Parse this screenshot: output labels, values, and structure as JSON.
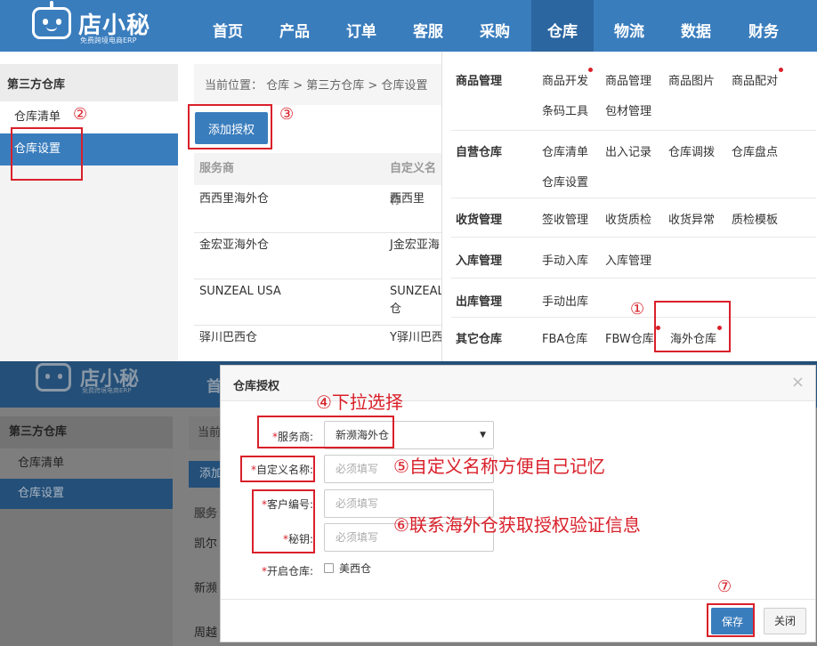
{
  "top": {
    "logo": {
      "text": "店小秘",
      "sub": "免费跨境电商ERP"
    },
    "nav": [
      "首页",
      "产品",
      "订单",
      "客服",
      "采购",
      "仓库",
      "物流",
      "数据",
      "财务"
    ],
    "sidebar": {
      "title": "第三方仓库",
      "items": [
        "仓库清单",
        "仓库设置"
      ]
    },
    "breadcrumb": "当前位置： 仓库 > 第三方仓库 > 仓库设置",
    "add_button": "添加授权",
    "table": {
      "headers": [
        "服务商",
        "自定义名称"
      ],
      "rows": [
        [
          "西西里海外仓",
          "西西里"
        ],
        [
          "金宏亚海外仓",
          "J金宏亚海"
        ],
        [
          "SUNZEAL USA",
          "SUNZEAL",
          "仓"
        ],
        [
          "驿川巴西仓",
          "Y驿川巴西"
        ]
      ]
    },
    "menu": {
      "sections": [
        {
          "name": "商品管理",
          "links": [
            "商品开发",
            "商品管理",
            "商品图片",
            "商品配对",
            "条码工具",
            "包材管理"
          ]
        },
        {
          "name": "自营仓库",
          "links": [
            "仓库清单",
            "出入记录",
            "仓库调拨",
            "仓库盘点",
            "仓库设置"
          ]
        },
        {
          "name": "收货管理",
          "links": [
            "签收管理",
            "收货质检",
            "收货异常",
            "质检模板"
          ]
        },
        {
          "name": "入库管理",
          "links": [
            "手动入库",
            "入库管理"
          ]
        },
        {
          "name": "出库管理",
          "links": [
            "手动出库"
          ]
        },
        {
          "name": "其它仓库",
          "links": [
            "FBA仓库",
            "FBW仓库",
            "海外仓库"
          ]
        }
      ]
    }
  },
  "bottom": {
    "logo": {
      "text": "店小秘",
      "sub": "免费跨境电商ERP"
    },
    "nav_first": "首",
    "sidebar": {
      "title": "第三方仓库",
      "items": [
        "仓库清单",
        "仓库设置"
      ]
    },
    "partial": {
      "breadcrumb": "当前",
      "add": "添加",
      "header": "服务",
      "rows": [
        "凯尔",
        "新濒",
        "周越"
      ]
    },
    "modal": {
      "title": "仓库授权",
      "close": "×",
      "fields": {
        "provider_label": "服务商:",
        "provider_value": "新濒海外仓",
        "custom_label": "自定义名称:",
        "custom_placeholder": "必须填写",
        "customer_label": "客户编号:",
        "customer_placeholder": "必须填写",
        "secret_label": "秘钥:",
        "secret_placeholder": "必须填写",
        "open_label": "开启仓库:",
        "open_option": "美西仓"
      },
      "save": "保存",
      "cancel": "关闭"
    }
  },
  "annotations": {
    "n1": "①",
    "n2": "②",
    "n3": "③",
    "n4": "④下拉选择",
    "n5": "⑤自定义名称方便自己记忆",
    "n6": "⑥联系海外仓获取授权验证信息",
    "n7": "⑦"
  },
  "colors": {
    "primary": "#3a7dbd",
    "annotation": "#d9202a"
  }
}
